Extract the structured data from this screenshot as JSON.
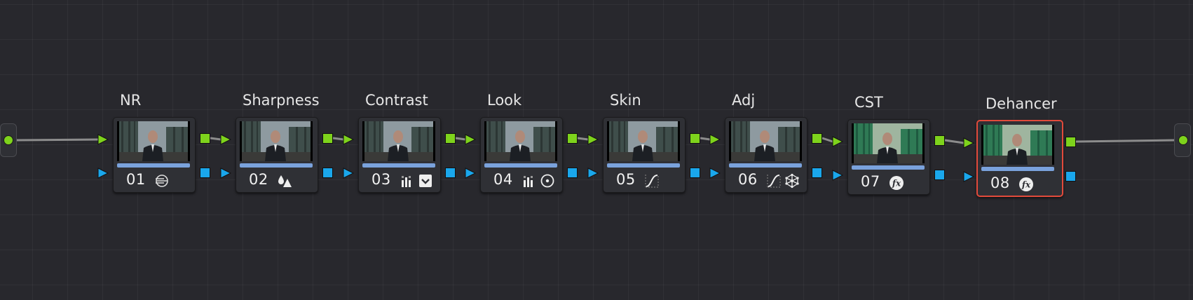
{
  "colors": {
    "background": "#28282d",
    "rgb_port": "#7ed31c",
    "key_port": "#1aa7ec",
    "selected_outline": "#e24a3b",
    "node_bar": "#7aa2dc",
    "link": "#8c8c8c"
  },
  "nodes": [
    {
      "label": "NR",
      "number": "01",
      "icons": [
        "noise-reduction-icon"
      ]
    },
    {
      "label": "Sharpness",
      "number": "02",
      "icons": [
        "blur-sharpen-icon"
      ]
    },
    {
      "label": "Contrast",
      "number": "03",
      "icons": [
        "color-bars-icon",
        "curves-check-icon"
      ]
    },
    {
      "label": "Look",
      "number": "04",
      "icons": [
        "color-bars-icon",
        "circle-window-icon"
      ]
    },
    {
      "label": "Skin",
      "number": "05",
      "icons": [
        "custom-curve-icon"
      ]
    },
    {
      "label": "Adj",
      "number": "06",
      "icons": [
        "custom-curve-icon",
        "color-warper-icon"
      ]
    },
    {
      "label": "CST",
      "number": "07",
      "icons": [
        "fx-icon"
      ]
    },
    {
      "label": "Dehancer",
      "number": "08",
      "icons": [
        "fx-icon"
      ],
      "selected": true
    }
  ]
}
